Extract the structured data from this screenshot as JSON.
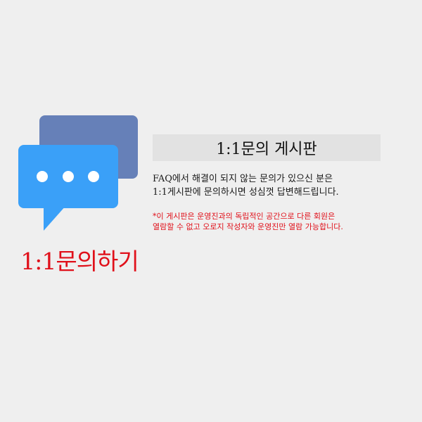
{
  "colors": {
    "background": "#efefef",
    "bubble_back": "#6680b8",
    "bubble_front": "#3aa0f8",
    "dots": "#ffffff",
    "accent_red": "#e0101a",
    "title_box": "#e2e2e2"
  },
  "icon": {
    "name": "chat-bubbles-icon"
  },
  "cta": {
    "label": "1:1문의하기"
  },
  "board": {
    "title": "1:1문의 게시판",
    "description": [
      "FAQ에서 해결이 되지 않는 문의가 있으신 분은",
      "1:1게시판에 문의하시면 성심껏 답변해드립니다."
    ],
    "notice": [
      "*이 게시판은 운영진과의 독립적인 공간으로 다른 회원은",
      "열람할 수 없고 오로지 작성자와 운영진만 열람 가능합니다."
    ]
  }
}
